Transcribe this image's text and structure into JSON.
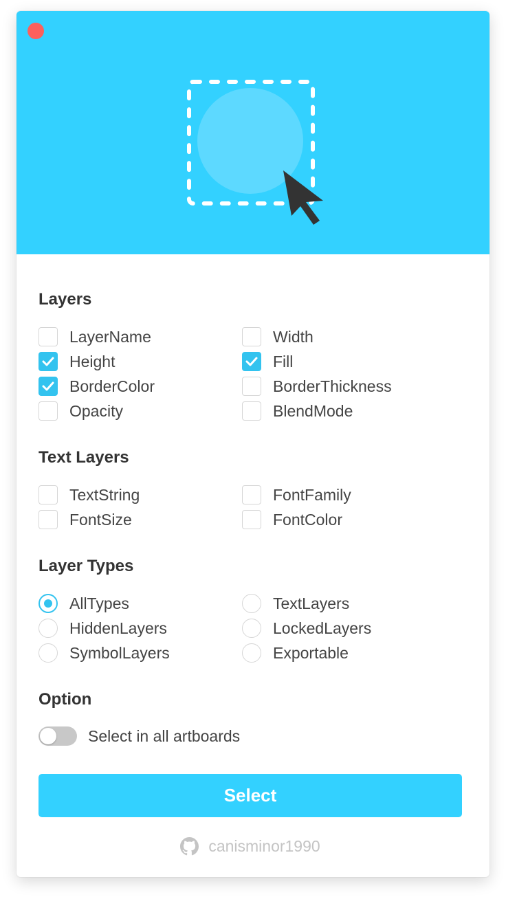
{
  "window": {
    "close_color": "#fc605c",
    "accent_color": "#33d1ff",
    "check_color": "#33c3ef"
  },
  "hero": {
    "icon": "selection-cursor-illustration"
  },
  "layers": {
    "title": "Layers",
    "options": [
      {
        "label": "LayerName",
        "checked": false
      },
      {
        "label": "Width",
        "checked": false
      },
      {
        "label": "Height",
        "checked": true
      },
      {
        "label": "Fill",
        "checked": true
      },
      {
        "label": "BorderColor",
        "checked": true
      },
      {
        "label": "BorderThickness",
        "checked": false
      },
      {
        "label": "Opacity",
        "checked": false
      },
      {
        "label": "BlendMode",
        "checked": false
      }
    ]
  },
  "text_layers": {
    "title": "Text Layers",
    "options": [
      {
        "label": "TextString",
        "checked": false
      },
      {
        "label": "FontFamily",
        "checked": false
      },
      {
        "label": "FontSize",
        "checked": false
      },
      {
        "label": "FontColor",
        "checked": false
      }
    ]
  },
  "layer_types": {
    "title": "Layer Types",
    "selected": "AllTypes",
    "options": [
      {
        "label": "AllTypes"
      },
      {
        "label": "TextLayers"
      },
      {
        "label": "HiddenLayers"
      },
      {
        "label": "LockedLayers"
      },
      {
        "label": "SymbolLayers"
      },
      {
        "label": "Exportable"
      }
    ]
  },
  "option": {
    "title": "Option",
    "toggle_label": "Select in all artboards",
    "toggle_on": false
  },
  "select_button": {
    "label": "Select"
  },
  "footer": {
    "icon": "github-icon",
    "username": "canisminor1990"
  }
}
